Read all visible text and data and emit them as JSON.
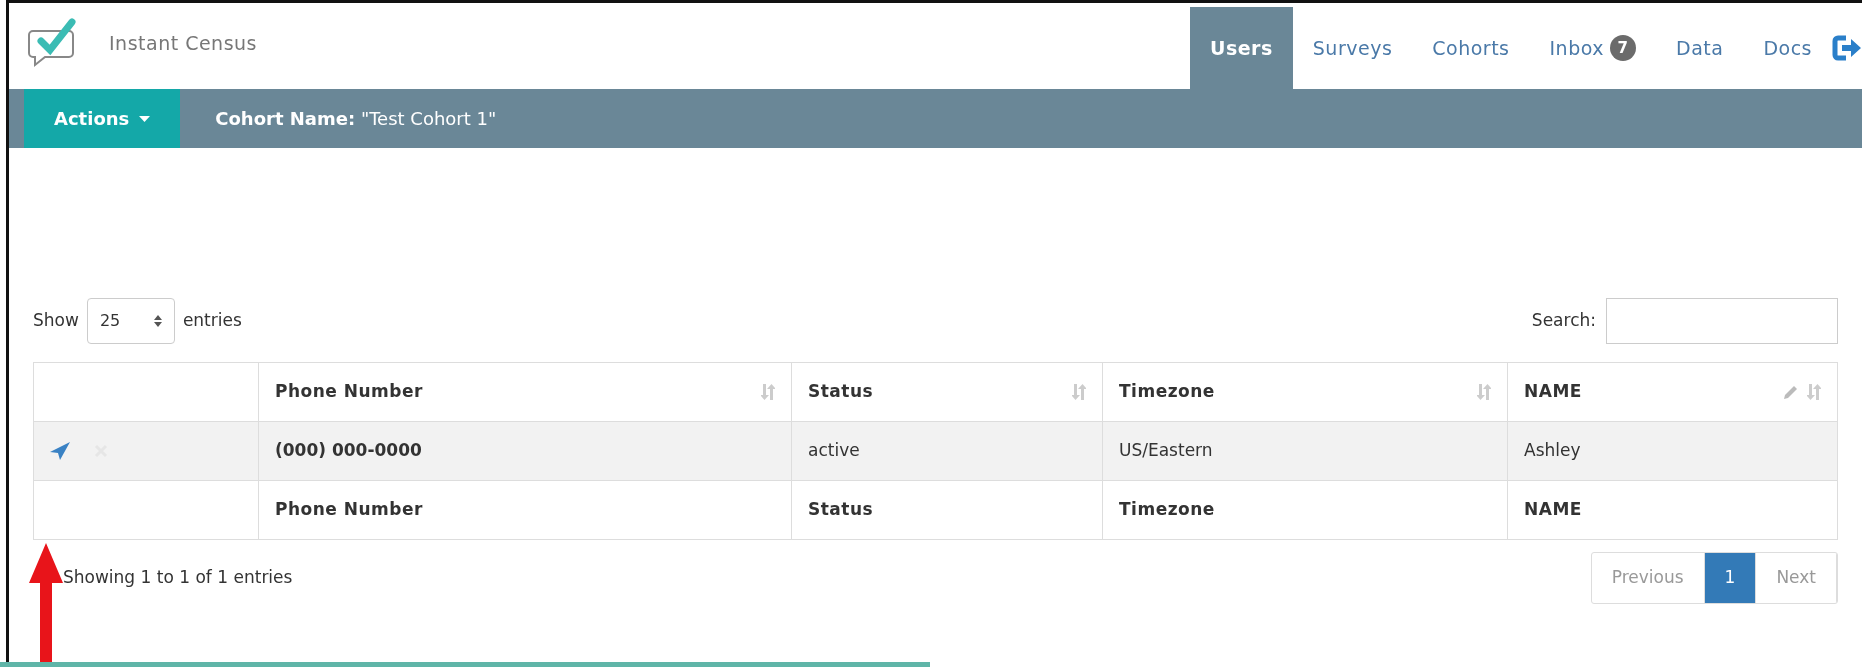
{
  "app": {
    "name": "Instant Census"
  },
  "nav": [
    {
      "label": "Users",
      "selected": true
    },
    {
      "label": "Surveys",
      "selected": false
    },
    {
      "label": "Cohorts",
      "selected": false
    },
    {
      "label": "Inbox",
      "selected": false,
      "badge": "7"
    },
    {
      "label": "Data",
      "selected": false
    },
    {
      "label": "Docs",
      "selected": false
    }
  ],
  "toolbar": {
    "actions": "Actions",
    "cohort_label": "Cohort Name:",
    "cohort_value": "\"Test Cohort 1\""
  },
  "length": {
    "prefix": "Show",
    "value": "25",
    "suffix": "entries"
  },
  "search": {
    "label": "Search:"
  },
  "table": {
    "columns": [
      {
        "label": "Phone Number",
        "editable": false
      },
      {
        "label": "Status",
        "editable": false
      },
      {
        "label": "Timezone",
        "editable": false
      },
      {
        "label": "NAME",
        "editable": true
      }
    ],
    "rows": [
      {
        "cells": [
          "(000) 000-0000",
          "active",
          "US/Eastern",
          "Ashley"
        ]
      }
    ],
    "footer": [
      "Phone Number",
      "Status",
      "Timezone",
      "NAME"
    ]
  },
  "info": "Showing 1 to 1 of 1 entries",
  "pagination": [
    {
      "label": "Previous",
      "selected": false
    },
    {
      "label": "1",
      "selected": true
    },
    {
      "label": "Next",
      "selected": false
    }
  ]
}
